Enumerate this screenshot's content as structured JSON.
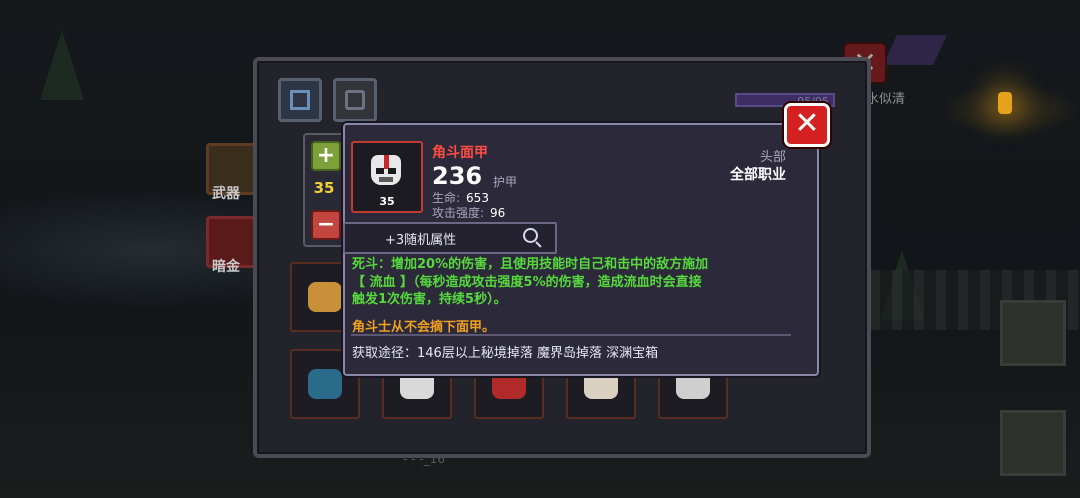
{
  "background": {
    "top_name": "水似清",
    "top_close_icon": "close-icon",
    "bottom_text": "- - -_16"
  },
  "panel": {
    "tabs": [
      {
        "icon": "inventory-tab-icon"
      },
      {
        "icon": "helmet-tab-icon"
      }
    ],
    "xp_text": "95/95",
    "side_slots": [
      {
        "label": "武器",
        "icon": "weapon-icon"
      },
      {
        "label": "暗金",
        "icon": "dark-gold-icon"
      }
    ],
    "grid_items": [
      {
        "icon": "golden-crown-item",
        "color": "#c9903a"
      },
      {
        "icon": "blue-hood-item",
        "color": "#2a6a8a"
      },
      {
        "icon": "skull-item",
        "color": "#d9d9d9"
      },
      {
        "icon": "red-helm-item",
        "color": "#b02a2a"
      },
      {
        "icon": "bone-item",
        "color": "#d9d0c0"
      },
      {
        "icon": "cracked-skull-item",
        "color": "#cfcfcf"
      }
    ]
  },
  "stepper": {
    "plus_label": "+",
    "minus_label": "−",
    "count": "35"
  },
  "tooltip": {
    "close_label": "✕",
    "item": {
      "name": "角斗面甲",
      "level": "35",
      "armor_value": "236",
      "armor_label": "护甲",
      "stats": [
        {
          "label": "生命:",
          "value": "653"
        },
        {
          "label": "攻击强度:",
          "value": "96"
        }
      ],
      "slot_type": "头部",
      "class_requirement": "全部职业"
    },
    "random_attribute": "+3随机属性",
    "effect_lines": [
      "死斗：增加20%的伤害，且使用技能时自己和击中的敌方施加",
      "【 流血 】（每秒造成攻击强度5%的伤害，造成流血时会直接",
      "触发1次伤害，持续5秒）。"
    ],
    "flavor": "角斗士从不会摘下面甲。",
    "source": "获取途径：146层以上秘境掉落 魔界岛掉落 深渊宝箱"
  },
  "colors": {
    "item_name": "#ff4d43",
    "effect_text": "#56d93c",
    "flavor_text": "#f0a020",
    "close_button": "#d42020"
  }
}
